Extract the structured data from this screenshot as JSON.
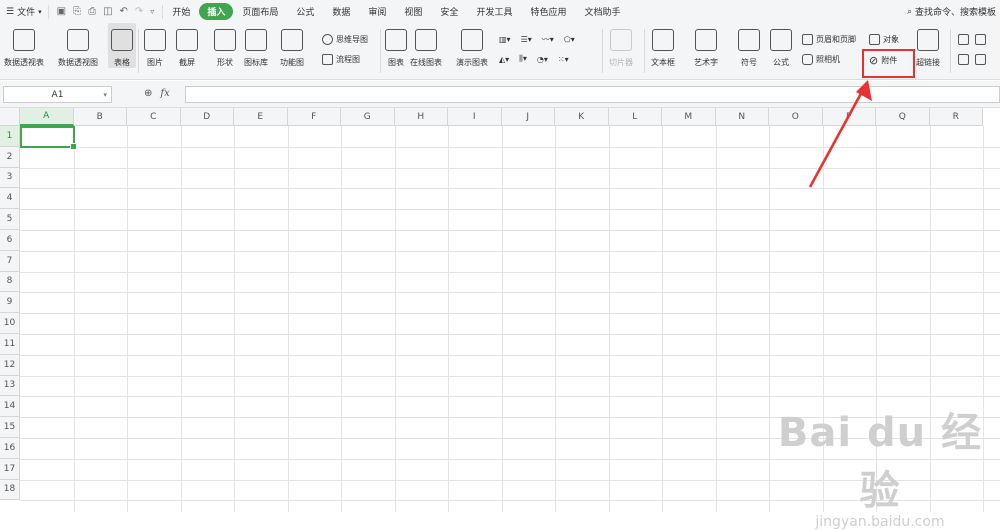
{
  "menu": {
    "file_label": "文件",
    "tabs": [
      "开始",
      "插入",
      "页面布局",
      "公式",
      "数据",
      "审阅",
      "视图",
      "安全",
      "开发工具",
      "特色应用",
      "文档助手"
    ],
    "active_tab": "插入",
    "search_label": "查找命令、搜索模板"
  },
  "ribbon": {
    "large": [
      {
        "label": "数据透视表",
        "icon": "pivot-table-icon"
      },
      {
        "label": "数据透视图",
        "icon": "pivot-chart-icon"
      },
      {
        "label": "表格",
        "icon": "table-icon"
      },
      {
        "label": "图片",
        "icon": "picture-icon"
      },
      {
        "label": "截屏",
        "icon": "screenshot-icon"
      },
      {
        "label": "形状",
        "icon": "shape-icon"
      },
      {
        "label": "图标库",
        "icon": "icon-library-icon"
      },
      {
        "label": "功能图",
        "icon": "function-chart-icon"
      },
      {
        "label": "图表",
        "icon": "chart-icon"
      },
      {
        "label": "在线图表",
        "icon": "online-chart-icon"
      },
      {
        "label": "演示图表",
        "icon": "demo-chart-icon"
      },
      {
        "label": "切片器",
        "icon": "slicer-icon"
      },
      {
        "label": "文本框",
        "icon": "textbox-icon"
      },
      {
        "label": "艺术字",
        "icon": "wordart-icon"
      },
      {
        "label": "符号",
        "icon": "symbol-icon"
      },
      {
        "label": "公式",
        "icon": "equation-icon"
      },
      {
        "label": "超链接",
        "icon": "hyperlink-icon"
      }
    ],
    "small": {
      "mindmap": "思维导图",
      "flowchart": "流程图",
      "header_footer": "页眉和页脚",
      "object": "对象",
      "camera": "照相机",
      "attachment": "附件"
    }
  },
  "formula_bar": {
    "name_box": "A1",
    "fx_label": "fx",
    "formula": ""
  },
  "sheet": {
    "columns": [
      "A",
      "B",
      "C",
      "D",
      "E",
      "F",
      "G",
      "H",
      "I",
      "J",
      "K",
      "L",
      "M",
      "N",
      "O",
      "P",
      "Q",
      "R"
    ],
    "rows": [
      "1",
      "2",
      "3",
      "4",
      "5",
      "6",
      "7",
      "8",
      "9",
      "10",
      "11",
      "12",
      "13",
      "14",
      "15",
      "16",
      "17",
      "18"
    ],
    "active_cell": "A1"
  },
  "watermark": {
    "line1": "Bai du 经验",
    "line2": "jingyan.baidu.com"
  },
  "colors": {
    "accent": "#3fa54e",
    "annotation": "#e8322f"
  }
}
